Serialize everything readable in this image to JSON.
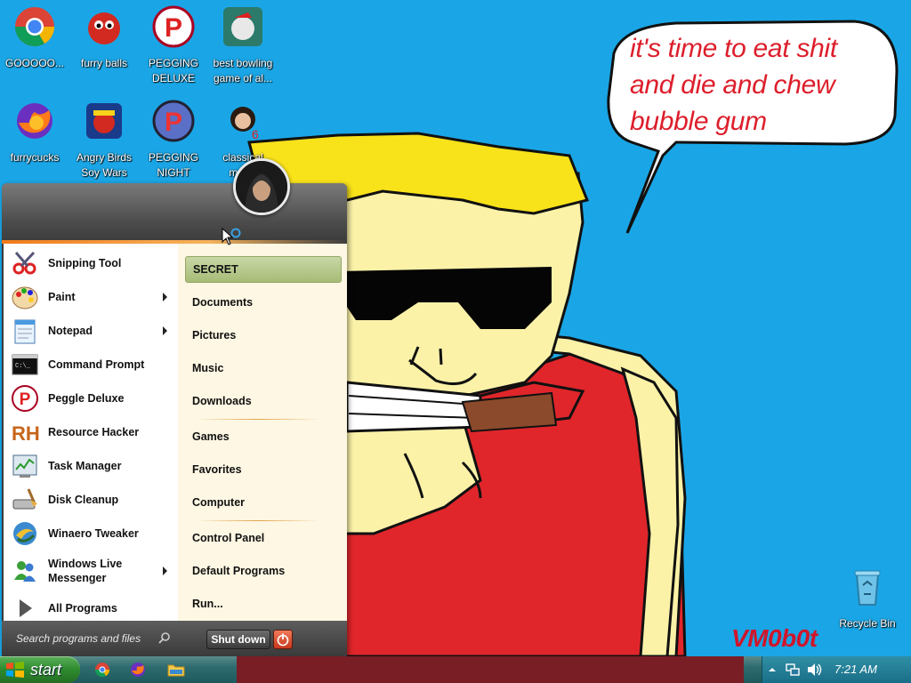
{
  "desktop": {
    "icons": [
      {
        "label": "GOOOOO..."
      },
      {
        "label": "furry balls"
      },
      {
        "label": "PEGGING DELUXE"
      },
      {
        "label": "best bowling game of al..."
      },
      {
        "label": "furrycucks"
      },
      {
        "label": "Angry Birds Soy Wars"
      },
      {
        "label": "PEGGING NIGHT"
      },
      {
        "label": "classical music"
      }
    ],
    "recycle_bin": "Recycle Bin",
    "wallpaper": {
      "speech_lines": [
        "it's time to eat shit",
        "and die and chew",
        "bubble gum"
      ],
      "signature": "VM0b0t",
      "colors": {
        "sky": "#1aa6e6",
        "hair": "#f8e21a",
        "skin": "#fbf2a8",
        "shirt": "#e0262b",
        "text": "#dd1e2b"
      }
    }
  },
  "start_menu": {
    "programs": [
      {
        "label": "Snipping Tool",
        "icon": "scissors-icon",
        "submenu": false
      },
      {
        "label": "Paint",
        "icon": "paint-palette-icon",
        "submenu": true
      },
      {
        "label": "Notepad",
        "icon": "notepad-icon",
        "submenu": true
      },
      {
        "label": "Command Prompt",
        "icon": "terminal-icon",
        "submenu": false
      },
      {
        "label": "Peggle Deluxe",
        "icon": "peggle-icon",
        "submenu": false
      },
      {
        "label": "Resource Hacker",
        "icon": "rh-icon",
        "submenu": false
      },
      {
        "label": "Task Manager",
        "icon": "task-manager-icon",
        "submenu": false
      },
      {
        "label": "Disk Cleanup",
        "icon": "disk-cleanup-icon",
        "submenu": false
      },
      {
        "label": "Winaero Tweaker",
        "icon": "winaero-icon",
        "submenu": false
      },
      {
        "label": "Windows Live Messenger",
        "icon": "messenger-icon",
        "submenu": true
      }
    ],
    "all_programs": "All Programs",
    "places": [
      {
        "label": "SECRET",
        "selected": true
      },
      {
        "label": "Documents"
      },
      {
        "label": "Pictures"
      },
      {
        "label": "Music"
      },
      {
        "label": "Downloads"
      },
      {
        "label": "Games"
      },
      {
        "label": "Favorites"
      },
      {
        "label": "Computer"
      },
      {
        "label": "Control Panel"
      },
      {
        "label": "Default Programs"
      },
      {
        "label": "Run..."
      }
    ],
    "search_placeholder": "Search programs and files",
    "shutdown_label": "Shut down"
  },
  "taskbar": {
    "start_label": "start",
    "pinned": [
      "chrome-icon",
      "firefox-icon",
      "folder-icon"
    ],
    "clock": "7:21 AM",
    "tray_icons": [
      "chevron-up-icon",
      "network-icon",
      "volume-icon"
    ]
  }
}
